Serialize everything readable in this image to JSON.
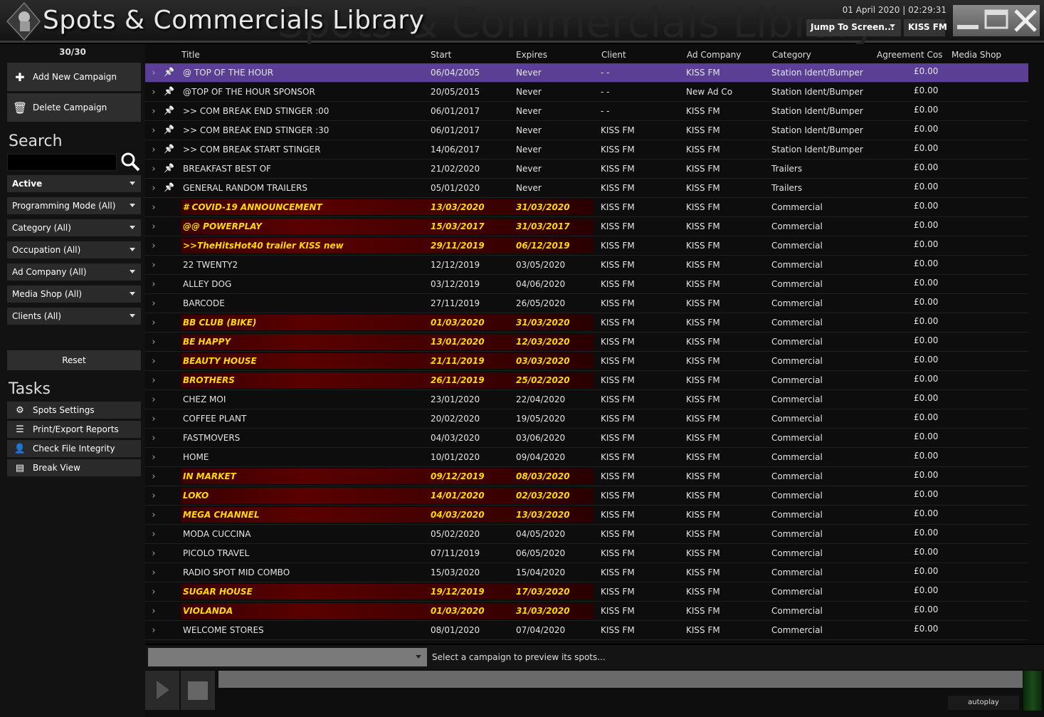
{
  "header": {
    "title": "Spots & Commercials Library",
    "datetime": "01 April 2020 | 02:29:31",
    "jump_to": "Jump To Screen...",
    "station": "KISS FM"
  },
  "sidebar": {
    "count": "30/30",
    "add_campaign": "Add New Campaign",
    "delete_campaign": "Delete Campaign",
    "search_heading": "Search",
    "search_value": "",
    "filters": {
      "status": "Active",
      "programming_mode": "Programming Mode (All)",
      "category": "Category (All)",
      "occupation": "Occupation (All)",
      "ad_company": "Ad Company (All)",
      "media_shop": "Media Shop (All)",
      "clients": "Clients (All)"
    },
    "reset": "Reset",
    "tasks_heading": "Tasks",
    "tasks": {
      "spots_settings": "Spots Settings",
      "print_export": "Print/Export Reports",
      "check_integrity": "Check File Integrity",
      "break_view": "Break View"
    }
  },
  "table": {
    "columns": {
      "title": "Title",
      "start": "Start",
      "expires": "Expires",
      "client": "Client",
      "ad_company": "Ad Company",
      "category": "Category",
      "agreement": "Agreement Cos",
      "media_shop": "Media Shop"
    },
    "rows": [
      {
        "title": "@ TOP OF THE HOUR",
        "start": "06/04/2005",
        "expires": "Never",
        "client": "- -",
        "ad_company": "KISS FM",
        "category": "Station Ident/Bumper",
        "cost": "£0.00",
        "pinned": true,
        "expiring": false,
        "selected": true
      },
      {
        "title": "@TOP OF THE HOUR SPONSOR",
        "start": "20/05/2015",
        "expires": "Never",
        "client": "- -",
        "ad_company": "New Ad Co",
        "category": "Station Ident/Bumper",
        "cost": "£0.00",
        "pinned": true,
        "expiring": false
      },
      {
        "title": ">> COM BREAK END STINGER :00",
        "start": "06/01/2017",
        "expires": "Never",
        "client": "- -",
        "ad_company": "KISS FM",
        "category": "Station Ident/Bumper",
        "cost": "£0.00",
        "pinned": true,
        "expiring": false
      },
      {
        "title": ">> COM BREAK END STINGER :30",
        "start": "06/01/2017",
        "expires": "Never",
        "client": "KISS FM",
        "ad_company": "KISS FM",
        "category": "Station Ident/Bumper",
        "cost": "£0.00",
        "pinned": true,
        "expiring": false
      },
      {
        "title": ">> COM BREAK START STINGER",
        "start": "14/06/2017",
        "expires": "Never",
        "client": "KISS FM",
        "ad_company": "KISS FM",
        "category": "Station Ident/Bumper",
        "cost": "£0.00",
        "pinned": true,
        "expiring": false
      },
      {
        "title": "BREAKFAST BEST OF",
        "start": "21/02/2020",
        "expires": "Never",
        "client": "KISS FM",
        "ad_company": "KISS FM",
        "category": "Trailers",
        "cost": "£0.00",
        "pinned": true,
        "expiring": false
      },
      {
        "title": "GENERAL RANDOM TRAILERS",
        "start": "05/01/2020",
        "expires": "Never",
        "client": "KISS FM",
        "ad_company": "KISS FM",
        "category": "Trailers",
        "cost": "£0.00",
        "pinned": true,
        "expiring": false
      },
      {
        "title": "# COVID-19 ANNOUNCEMENT",
        "start": "13/03/2020",
        "expires": "31/03/2020",
        "client": "KISS FM",
        "ad_company": "KISS FM",
        "category": "Commercial",
        "cost": "£0.00",
        "pinned": false,
        "expiring": true
      },
      {
        "title": "@@ POWERPLAY",
        "start": "15/03/2017",
        "expires": "31/03/2017",
        "client": "KISS FM",
        "ad_company": "KISS FM",
        "category": "Commercial",
        "cost": "£0.00",
        "pinned": false,
        "expiring": true
      },
      {
        "title": ">>TheHitsHot40 trailer KISS new",
        "start": "29/11/2019",
        "expires": "06/12/2019",
        "client": "KISS FM",
        "ad_company": "KISS FM",
        "category": "Commercial",
        "cost": "£0.00",
        "pinned": false,
        "expiring": true
      },
      {
        "title": "22 TWENTY2",
        "start": "12/12/2019",
        "expires": "03/05/2020",
        "client": "KISS FM",
        "ad_company": "KISS FM",
        "category": "Commercial",
        "cost": "£0.00",
        "pinned": false,
        "expiring": false
      },
      {
        "title": "ALLEY DOG",
        "start": "03/12/2019",
        "expires": "04/06/2020",
        "client": "KISS FM",
        "ad_company": "KISS FM",
        "category": "Commercial",
        "cost": "£0.00",
        "pinned": false,
        "expiring": false
      },
      {
        "title": "BARCODE",
        "start": "27/11/2019",
        "expires": "26/05/2020",
        "client": "KISS FM",
        "ad_company": "KISS FM",
        "category": "Commercial",
        "cost": "£0.00",
        "pinned": false,
        "expiring": false
      },
      {
        "title": "BB CLUB (BIKE)",
        "start": "01/03/2020",
        "expires": "31/03/2020",
        "client": "KISS FM",
        "ad_company": "KISS FM",
        "category": "Commercial",
        "cost": "£0.00",
        "pinned": false,
        "expiring": true
      },
      {
        "title": "BE HAPPY",
        "start": "13/01/2020",
        "expires": "12/03/2020",
        "client": "KISS FM",
        "ad_company": "KISS FM",
        "category": "Commercial",
        "cost": "£0.00",
        "pinned": false,
        "expiring": true
      },
      {
        "title": "BEAUTY HOUSE",
        "start": "21/11/2019",
        "expires": "03/03/2020",
        "client": "KISS FM",
        "ad_company": "KISS FM",
        "category": "Commercial",
        "cost": "£0.00",
        "pinned": false,
        "expiring": true
      },
      {
        "title": "BROTHERS",
        "start": "26/11/2019",
        "expires": "25/02/2020",
        "client": "KISS FM",
        "ad_company": "KISS FM",
        "category": "Commercial",
        "cost": "£0.00",
        "pinned": false,
        "expiring": true
      },
      {
        "title": "CHEZ MOI",
        "start": "23/01/2020",
        "expires": "22/04/2020",
        "client": "KISS FM",
        "ad_company": "KISS FM",
        "category": "Commercial",
        "cost": "£0.00",
        "pinned": false,
        "expiring": false
      },
      {
        "title": "COFFEE PLANT",
        "start": "20/02/2020",
        "expires": "19/05/2020",
        "client": "KISS FM",
        "ad_company": "KISS FM",
        "category": "Commercial",
        "cost": "£0.00",
        "pinned": false,
        "expiring": false
      },
      {
        "title": "FASTMOVERS",
        "start": "04/03/2020",
        "expires": "03/06/2020",
        "client": "KISS FM",
        "ad_company": "KISS FM",
        "category": "Commercial",
        "cost": "£0.00",
        "pinned": false,
        "expiring": false
      },
      {
        "title": "HOME",
        "start": "10/01/2020",
        "expires": "09/04/2020",
        "client": "KISS FM",
        "ad_company": "KISS FM",
        "category": "Commercial",
        "cost": "£0.00",
        "pinned": false,
        "expiring": false
      },
      {
        "title": "IN MARKET",
        "start": "09/12/2019",
        "expires": "08/03/2020",
        "client": "KISS FM",
        "ad_company": "KISS FM",
        "category": "Commercial",
        "cost": "£0.00",
        "pinned": false,
        "expiring": true
      },
      {
        "title": "LOKO",
        "start": "14/01/2020",
        "expires": "02/03/2020",
        "client": "KISS FM",
        "ad_company": "KISS FM",
        "category": "Commercial",
        "cost": "£0.00",
        "pinned": false,
        "expiring": true
      },
      {
        "title": "MEGA CHANNEL",
        "start": "04/03/2020",
        "expires": "13/03/2020",
        "client": "KISS FM",
        "ad_company": "KISS FM",
        "category": "Commercial",
        "cost": "£0.00",
        "pinned": false,
        "expiring": true
      },
      {
        "title": "MODA CUCCINA",
        "start": "05/02/2020",
        "expires": "04/05/2020",
        "client": "KISS FM",
        "ad_company": "KISS FM",
        "category": "Commercial",
        "cost": "£0.00",
        "pinned": false,
        "expiring": false
      },
      {
        "title": "PICOLO TRAVEL",
        "start": "07/11/2019",
        "expires": "06/05/2020",
        "client": "KISS FM",
        "ad_company": "KISS FM",
        "category": "Commercial",
        "cost": "£0.00",
        "pinned": false,
        "expiring": false
      },
      {
        "title": "RADIO SPOT MID COMBO",
        "start": "15/03/2020",
        "expires": "15/04/2020",
        "client": "KISS FM",
        "ad_company": "KISS FM",
        "category": "Commercial",
        "cost": "£0.00",
        "pinned": false,
        "expiring": false
      },
      {
        "title": "SUGAR HOUSE",
        "start": "19/12/2019",
        "expires": "17/03/2020",
        "client": "KISS FM",
        "ad_company": "KISS FM",
        "category": "Commercial",
        "cost": "£0.00",
        "pinned": false,
        "expiring": true
      },
      {
        "title": "VIOLANDA",
        "start": "01/03/2020",
        "expires": "31/03/2020",
        "client": "KISS FM",
        "ad_company": "KISS FM",
        "category": "Commercial",
        "cost": "£0.00",
        "pinned": false,
        "expiring": true
      },
      {
        "title": "WELCOME STORES",
        "start": "08/01/2020",
        "expires": "07/04/2020",
        "client": "KISS FM",
        "ad_company": "KISS FM",
        "category": "Commercial",
        "cost": "£0.00",
        "pinned": false,
        "expiring": false
      }
    ]
  },
  "preview": {
    "selected": "",
    "message": "Select a campaign to preview its spots...",
    "autoplay": "autoplay"
  },
  "colors": {
    "selected_row": "#5a3f94",
    "expiring_text": "#ffd800",
    "expiring_bg": "#5a0000"
  }
}
